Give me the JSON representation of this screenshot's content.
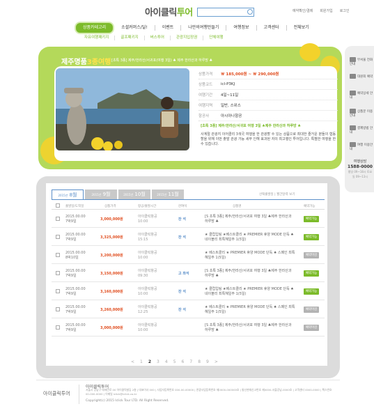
{
  "header": {
    "logo_main": "아이클릭",
    "logo_accent": "투어",
    "search_placeholder": "",
    "top_links": [
      "예약확인/결제",
      "회원가입",
      "로그인"
    ]
  },
  "nav": {
    "items": [
      "상품카테고리",
      "소셜커머스/딜!",
      "이벤트",
      "나만의여행만들기",
      "여행정보",
      "고객센터",
      "전체보기"
    ]
  },
  "subnav": {
    "items": [
      "자유여행패키지",
      "골프패키지",
      "버스투어",
      "관광지입장권",
      "단체여행"
    ]
  },
  "banner": {
    "title_main": "제주명품",
    "title_accent": "3종여행",
    "subtitle": "[초특 3종] 제주/한라산/서귀포(여행 3일) ♣ 제주 한라산과 하루방 ♣",
    "rows": [
      {
        "label": "상품가격",
        "value": "￦ 185,000원 ~ ￦ 290,000원"
      },
      {
        "label": "상품코드",
        "value": "icl-P3KJ"
      },
      {
        "label": "여행기간",
        "value": "4일~11일"
      },
      {
        "label": "여행지역",
        "value": "일반, 스위스"
      },
      {
        "label": "항공사",
        "value": "아시아나항공"
      }
    ],
    "desc_title": "[초특 3종] 제주/한라산/서귀포 여행 3일 ♣제주 한라산과 하루방 ♣",
    "desc_body": "사계절 관광지 이어클리 3색국 여행을 한 관광할 수 있는 상품으로 최대한 즐거운 분들의 협동할을 위해 이번 출발 관광 가능 세부 인해 효과된 자의 최고행인 투어입니다. 특별한 여행을 한 수 있습니다."
  },
  "sidebar": {
    "items": [
      "무서울 전화안내",
      "대원최 예약",
      "예약상세 안내",
      "상품문 이용안내",
      "결제방법 안내",
      "여행 이용안내"
    ],
    "phone_label": "여행상담",
    "phone": "1588-0000",
    "hours": "평일 09~18시 토요일 09~13시"
  },
  "listing": {
    "tabs": [
      {
        "year": "2015년",
        "month": "8월"
      },
      {
        "year": "2015년",
        "month": "9월"
      },
      {
        "year": "2015년",
        "month": "10월"
      },
      {
        "year": "2015년",
        "month": "11월"
      }
    ],
    "tools": "선택출발일 | 월간달력 보기",
    "headers": [
      "출발일/도착일",
      "상품가격",
      "항공/출발시간",
      "잔여석",
      "상품명",
      "예약가능"
    ],
    "rows": [
      {
        "date": "2015.00.00",
        "day": "7박9일",
        "price": "3,000,000원",
        "air": "아이클릭항공",
        "time": "10:00",
        "seat": "잔 석",
        "name": "[S 초특 3종] 제주/한라산/서귀포 여행 3일 ♣제주 한라산과 하루방 ♣",
        "btn": "예약가능",
        "on": true
      },
      {
        "date": "2015.00.00",
        "day": "7박9일",
        "price": "3,325,000원",
        "air": "아이클릭항공",
        "time": "15:15",
        "seat": "잔 석",
        "name": "★ 클럽입팅 ★베스트클리 ★ PREMIER 휴양 MODE 단독 ♠ 네이블리 최특혜일주 1(5일)",
        "btn": "예약가능",
        "on": true
      },
      {
        "date": "2015.00.00",
        "day": "8박10일",
        "price": "3,200,000원",
        "air": "아이클릭항공",
        "time": "10:00",
        "seat": "",
        "name": "★ 베스트클리 ★ PREMIER 휴양 MODE 단독 ♠ 스페인 최특혜일주 1(5일)",
        "btn": "예약마감",
        "on": false
      },
      {
        "date": "2015.00.00",
        "day": "7박9일",
        "price": "3,150,000원",
        "air": "아이클릭항공",
        "time": "09:30",
        "seat": "고 좌석",
        "name": "[S 초특 3종] 제주/한라산/서귀포 여행 3일 ♣제주 한라산과 하루방 ♣",
        "btn": "예약가능",
        "on": true
      },
      {
        "date": "2015.00.00",
        "day": "7박9일",
        "price": "3,160,000원",
        "air": "아이클릭항공",
        "time": "10:00",
        "seat": "잔 석",
        "name": "★ 클럽입팅 ★베스트클리 ★ PREMIER 휴양 MODE 단독 ♠ 네이블리 최특혜일주 1(5일)",
        "btn": "예약가능",
        "on": true
      },
      {
        "date": "2015.00.00",
        "day": "7박9일",
        "price": "3,260,000원",
        "air": "아이클릭항공",
        "time": "12:25",
        "seat": "잔 석",
        "name": "★ 베스트클리 ★ PREMIER 휴양 MODE 단독 ♠ 스페인 최특혜일주 1(5일)",
        "btn": "예약마감",
        "on": false
      },
      {
        "date": "2015.00.00",
        "day": "7박9일",
        "price": "3,000,000원",
        "air": "아이클릭항공",
        "time": "10:00",
        "seat": "",
        "name": "[S 초특 3종] 제주/한라산/서귀포 여행 3일 ♣제주 한라산과 하루방 ♣",
        "btn": "예약마감",
        "on": false
      }
    ],
    "pages": [
      "<",
      "1",
      "2",
      "3",
      "4",
      "5",
      "6",
      "7",
      "8",
      "9",
      ">"
    ],
    "current_page": "2"
  },
  "footer": {
    "logo": "아이클릭투어",
    "company": "아이클릭투어",
    "info": "서울시 강남구 테헤란로 00 아이클릭빌딩 2층 | 대표이사 000 | 사업자등록번호 000-00-00000 | 관광사업등록번호 제0000-000000호 | 통신판매신고번호 제0000-서울강남-0000호 | 고객센터 0000-0000 | 팩스번호 00-000-0000 | 이메일 iclick@iclick.co.kr",
    "copyright": "Copyright(c) 2015 Iclick Tour LTD.  All Right Reserved."
  },
  "colors": {
    "accent": "#7cbb2a",
    "price": "#e04b1c",
    "link": "#5b8fc9"
  }
}
